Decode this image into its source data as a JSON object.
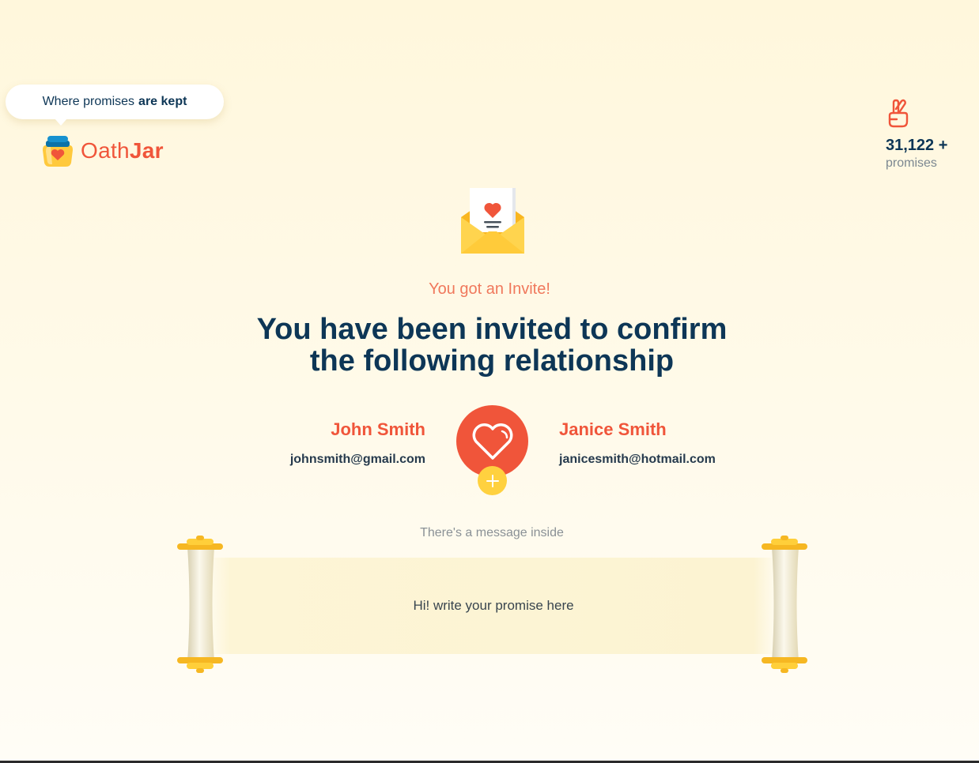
{
  "brand": {
    "tagline_prefix": "Where promises",
    "tagline_bold": "are kept",
    "logo_part1": "Oath",
    "logo_part2": "Jar"
  },
  "stats": {
    "promises_count": "31,122 +",
    "promises_label": "promises",
    "icon": "crossed-fingers-icon"
  },
  "invite": {
    "eyebrow": "You got an Invite!",
    "headline_line1": "You have been invited to confirm",
    "headline_line2": "the following relationship"
  },
  "people": [
    {
      "name": "John Smith",
      "email": "johnsmith@gmail.com"
    },
    {
      "name": "Janice Smith",
      "email": "janicesmith@hotmail.com"
    }
  ],
  "message": {
    "caption": "There's a message inside",
    "placeholder": "Hi! write your promise here"
  },
  "colors": {
    "accent": "#f0553a",
    "navy": "#0d3656",
    "yellow": "#ffd13f",
    "background": "#fff7dc"
  }
}
